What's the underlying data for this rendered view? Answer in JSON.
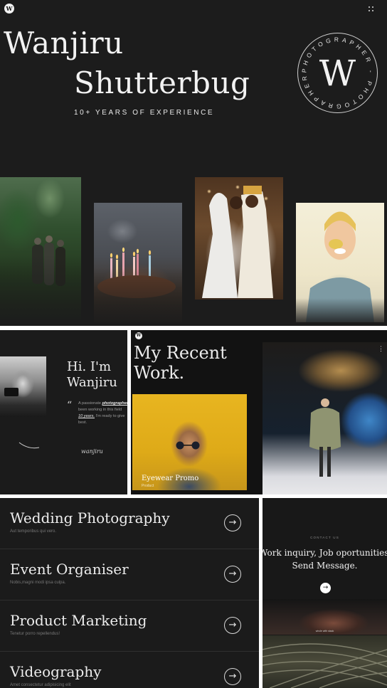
{
  "hero": {
    "logo_letter": "W",
    "name_line1": "Wanjiru",
    "name_line2": "Shutterbug",
    "subtitle": "10+ YEARS OF EXPERIENCE",
    "badge_letter": "W",
    "badge_ring_text": "PHOTOGRAPHER - PHOTOGRAPHER -"
  },
  "about": {
    "title_line1": "Hi. I'm",
    "title_line2": "Wanjiru",
    "quote_mark": "“",
    "text_line1_prefix": "A passionate ",
    "text_line1_em": "photographer",
    "text_line2": "been working in this field",
    "text_line3_em": "10 years.",
    "text_line3_rest": " I'm ready to give",
    "text_line4": "best.",
    "signature": "wanjiru"
  },
  "work": {
    "logo_letter": "W",
    "title_line1": "My Recent",
    "title_line2": "Work.",
    "card1_title": "Eyewear Promo",
    "card1_sub": "Product",
    "more_icon": "⋮"
  },
  "services": [
    {
      "title": "Wedding Photography",
      "sub": "Aut temporibus qui vero.",
      "arrow": "→"
    },
    {
      "title": "Event Organiser",
      "sub": "Nobis,magni modi ipsa culpa.",
      "arrow": "→"
    },
    {
      "title": "Product Marketing",
      "sub": "Tenetur porro repellendus!",
      "arrow": "→"
    },
    {
      "title": "Videography",
      "sub": "Amet consectetur adipisicing elit",
      "arrow": "→"
    }
  ],
  "contact": {
    "label": "CONTACT US",
    "line1": "Work inquiry, Job oportunities?",
    "line2": "Send Message.",
    "button_icon": "→",
    "img_caption": "whole with stack"
  },
  "colors": {
    "background": "#1b1b1b",
    "text": "#f2f2f2",
    "muted": "#777777",
    "accent_yellow": "#e8b520"
  },
  "icons": {
    "menu": "grid-dots-icon",
    "arrow": "arrow-right-icon"
  }
}
